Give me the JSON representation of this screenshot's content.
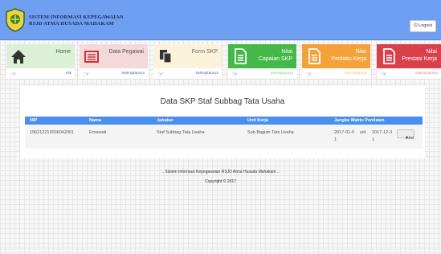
{
  "header": {
    "brand_line1": "SISTEM INFORMASI KEPEGAWAIAN",
    "brand_line2": "RSJD ATMA HUSADA MAHAKAM",
    "logout_label": "Logout",
    "logout_icon": "power-icon",
    "colors": {
      "header_bg": "#6f9ff0"
    }
  },
  "tiles": [
    {
      "title": "Home",
      "title2": "",
      "link": "Klik",
      "icon": "home-icon"
    },
    {
      "title": "Data Pegawai",
      "title2": "",
      "link": "Selengkapnya",
      "icon": "list-icon"
    },
    {
      "title": "Form SKP",
      "title2": "",
      "link": "Selengkapnya",
      "icon": "copy-icon"
    },
    {
      "title": "Nilai",
      "title2": "Capaian SKP",
      "link": "Selengkapnya",
      "icon": "document-icon",
      "color": "#45b84a"
    },
    {
      "title": "Nilai",
      "title2": "Perilaku Kerja",
      "link": "Selengkapnya",
      "icon": "document-icon",
      "color": "#f3a23a"
    },
    {
      "title": "Nilai",
      "title2": "Prestasi Kerja",
      "link": "Selengkapnya",
      "icon": "document-icon",
      "color": "#d9404a"
    }
  ],
  "panel": {
    "title": "Data SKP Staf Subbag Tata Usaha",
    "columns": [
      "NIP",
      "Nama",
      "Jabatan",
      "Unit Kerja",
      "Jangka Waktu Penilaian"
    ],
    "rows": [
      {
        "nip": "196212212006042001",
        "nama": "Ernawati",
        "jabatan": "Staf Subbag Tata Usaha",
        "unit": "Sub Bagian Tata Usaha",
        "from": "2017-01-01",
        "sd": "s/d",
        "to": "2017-12-31",
        "action": "Aksi"
      }
    ]
  },
  "footer": {
    "line1": ".. Sistem Informasi Kepegawaian RSJD Atma Husada Mahakam ..",
    "line2": "Copyright © 2017"
  }
}
